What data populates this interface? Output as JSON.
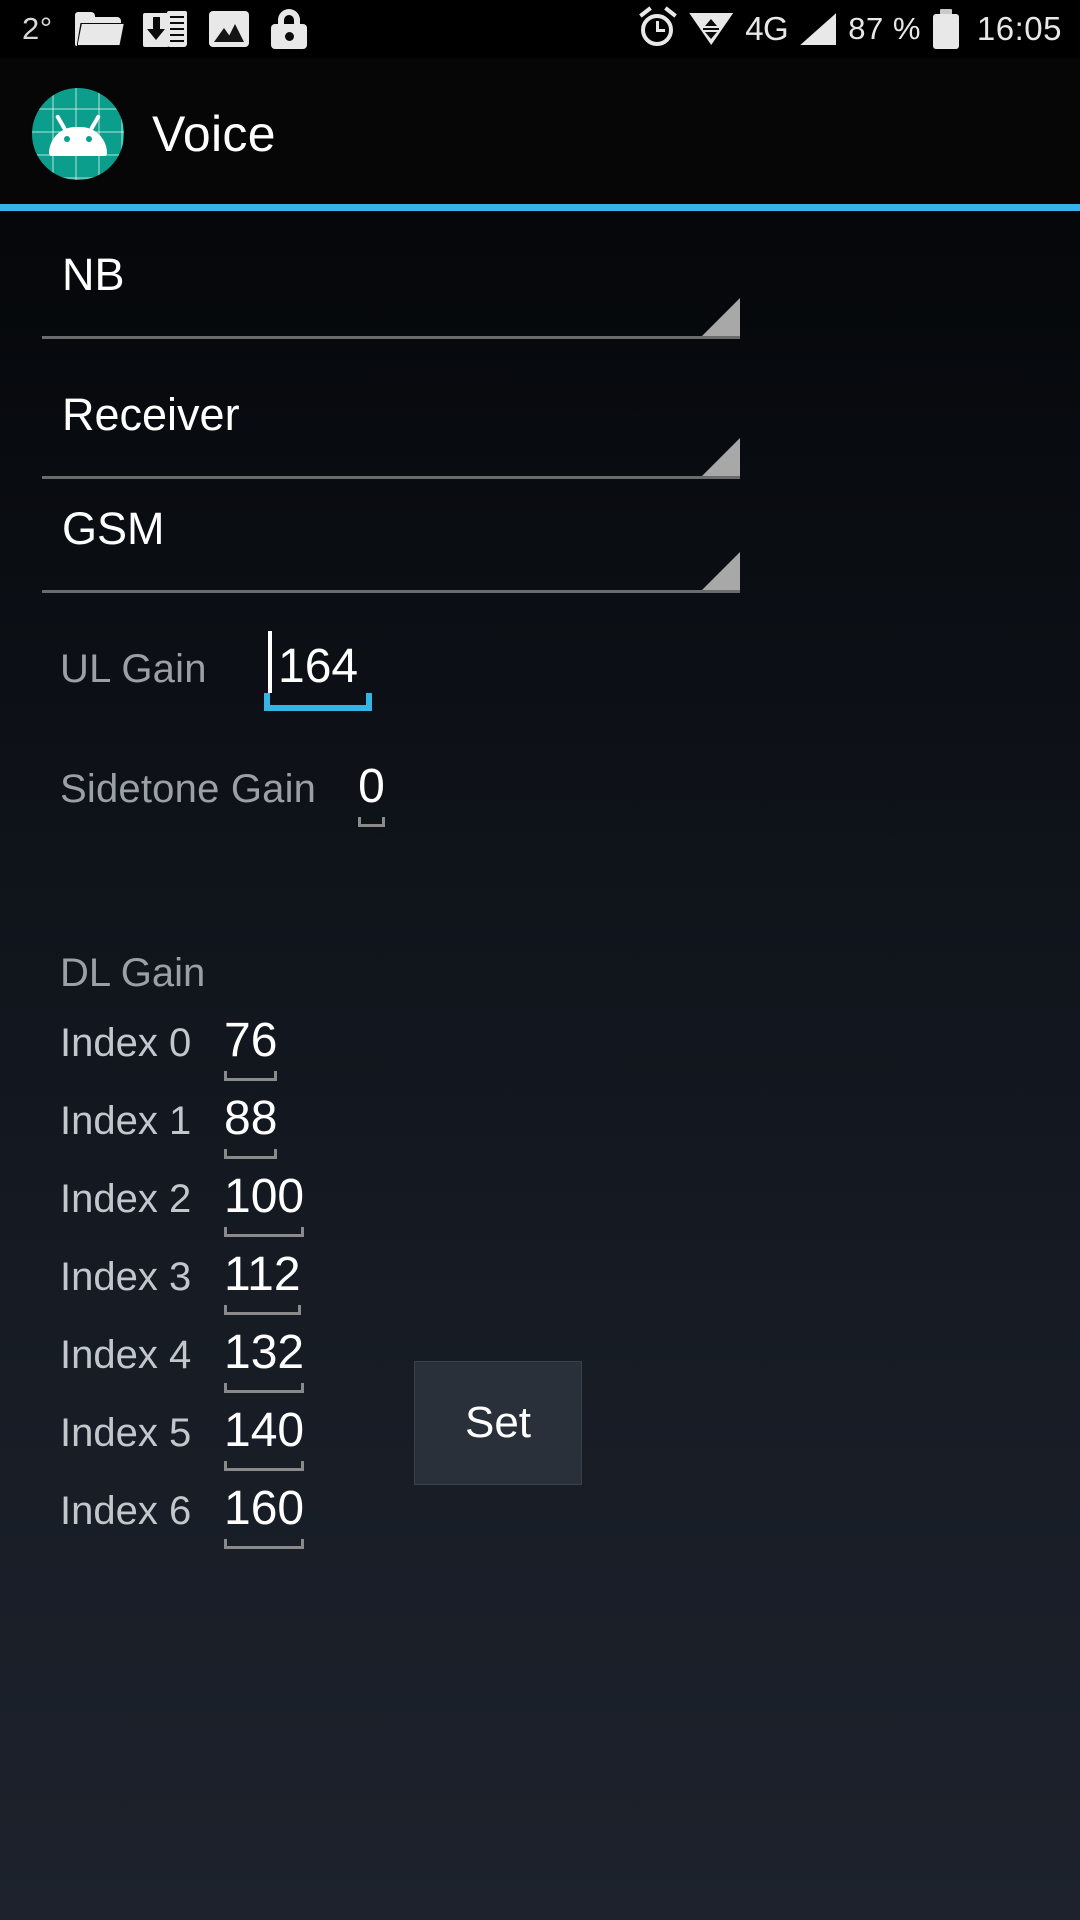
{
  "status_bar": {
    "temperature": "2°",
    "icons_left": [
      "folder-icon",
      "sd-card-download-icon",
      "picture-icon",
      "lock-icon"
    ],
    "icons_right": [
      "alarm-icon",
      "wifi-icon",
      "signal-icon",
      "battery-icon"
    ],
    "network": "4G",
    "battery_percent": "87 %",
    "time": "16:05"
  },
  "app_bar": {
    "title": "Voice",
    "icon": "android-robot-icon",
    "icon_color": "#0c9e8c",
    "accent_color": "#33b5e5"
  },
  "spinners": [
    {
      "name": "band-spinner",
      "value": "NB"
    },
    {
      "name": "output-device-spinner",
      "value": "Receiver"
    },
    {
      "name": "network-mode-spinner",
      "value": "GSM"
    }
  ],
  "fields": {
    "ul_gain": {
      "label": "UL Gain",
      "value": "164",
      "focused": true
    },
    "sidetone_gain": {
      "label": "Sidetone Gain",
      "value": "0",
      "focused": false
    }
  },
  "dl_gain": {
    "title": "DL Gain",
    "rows": [
      {
        "label": "Index 0",
        "value": "76"
      },
      {
        "label": "Index 1",
        "value": "88"
      },
      {
        "label": "Index 2",
        "value": "100"
      },
      {
        "label": "Index 3",
        "value": "112"
      },
      {
        "label": "Index 4",
        "value": "132"
      },
      {
        "label": "Index 5",
        "value": "140"
      },
      {
        "label": "Index 6",
        "value": "160"
      }
    ]
  },
  "actions": {
    "set_label": "Set"
  }
}
